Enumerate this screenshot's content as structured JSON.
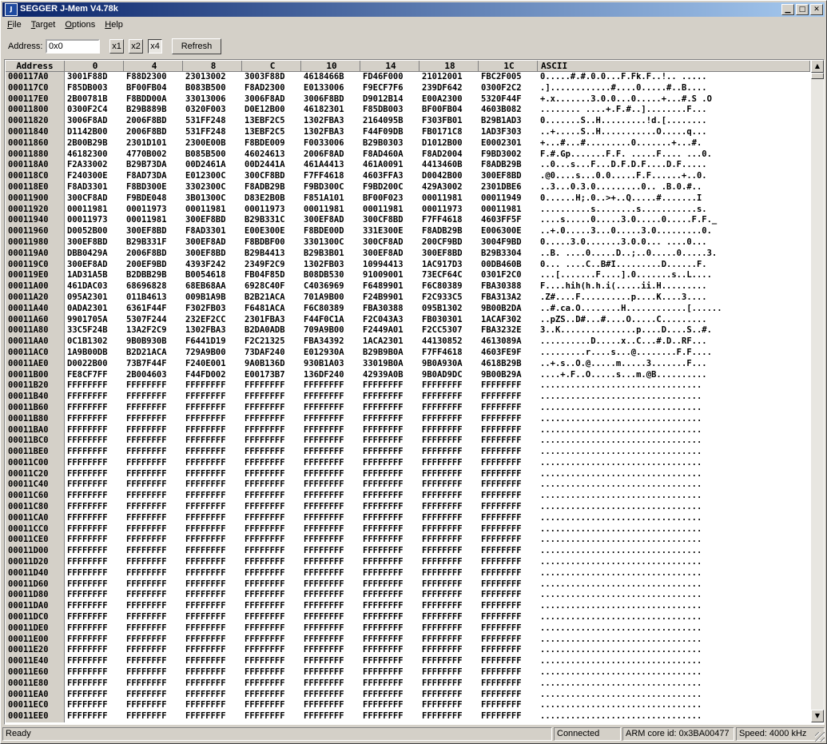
{
  "window": {
    "title": "SEGGER J-Mem V4.78k",
    "icon_text": "J"
  },
  "menu": [
    {
      "label": "File",
      "key": "F"
    },
    {
      "label": "Target",
      "key": "T"
    },
    {
      "label": "Options",
      "key": "O"
    },
    {
      "label": "Help",
      "key": "H"
    }
  ],
  "toolbar": {
    "address_label": "Address:",
    "address_value": "0x0",
    "zoom_buttons": [
      "x1",
      "x2",
      "x4"
    ],
    "zoom_selected": "x4",
    "refresh_label": "Refresh"
  },
  "grid": {
    "headers": [
      "Address",
      "0",
      "4",
      "8",
      "C",
      "10",
      "14",
      "18",
      "1C",
      "ASCII"
    ],
    "rows": [
      [
        "000117A0",
        "3001F88D",
        "F88D2300",
        "23013002",
        "3003F88D",
        "4618466B",
        "FD46F000",
        "21012001",
        "FBC2F005",
        "0.....#.#.0.0...F.Fk.F..!.. ....."
      ],
      [
        "000117C0",
        "F85DB003",
        "BF00FB04",
        "B083B500",
        "F8AD2300",
        "E0133006",
        "F9ECF7F6",
        "239DF642",
        "0300F2C2",
        ".]............#....0.....#..B...."
      ],
      [
        "000117E0",
        "2B00781B",
        "F8BDD00A",
        "33013006",
        "3006F8AD",
        "3006F8BD",
        "D9012B14",
        "E00A2300",
        "5320F44F",
        "+.x.......3.0.0...0.....+...#.S .O"
      ],
      [
        "00011800",
        "0300F2C4",
        "B29B889B",
        "0320F003",
        "D0E12B00",
        "46182301",
        "F85DB003",
        "BF00FB04",
        "4603B082",
        "........ ....+.F.#..]........F..."
      ],
      [
        "00011820",
        "3006F8AD",
        "2006F8BD",
        "531FF248",
        "13EBF2C5",
        "1302FBA3",
        "2164095B",
        "F303FB01",
        "B29B1AD3",
        "0.......S..H.........!d.[........"
      ],
      [
        "00011840",
        "D1142B00",
        "2006F8BD",
        "531FF248",
        "13EBF2C5",
        "1302FBA3",
        "F44F09DB",
        "FB0171C8",
        "1AD3F303",
        "..+.....S..H...........O.....q..."
      ],
      [
        "00011860",
        "2B00B29B",
        "2301D101",
        "2300E00B",
        "F8BDE009",
        "F0033006",
        "B29B0303",
        "D1012B00",
        "E0002301",
        "+...#...#.........0.......+...#."
      ],
      [
        "00011880",
        "46182300",
        "4770B002",
        "B085B500",
        "46024613",
        "2006F8AD",
        "F8AD460A",
        "F8AD2004",
        "F9BD3002",
        "F.#.Gp.......F.F. .....F.... ...0."
      ],
      [
        "000118A0",
        "F2A33002",
        "B29B73DA",
        "00D2461A",
        "00D2441A",
        "461A4413",
        "461A0091",
        "4413460B",
        "F8ADB29B",
        "..0...s...F...D.F.D.F....D.F....."
      ],
      [
        "000118C0",
        "F240300E",
        "F8AD73DA",
        "E012300C",
        "300CF8BD",
        "F7FF4618",
        "4603FFA3",
        "D0042B00",
        "300EF8BD",
        ".@0....s...0.0.....F.F......+..0."
      ],
      [
        "000118E0",
        "F8AD3301",
        "F8BD300E",
        "3302300C",
        "F8ADB29B",
        "F9BD300C",
        "F9BD200C",
        "429A3002",
        "2301DBE6",
        "..3...0.3.0.........0.. .B.0.#.."
      ],
      [
        "00011900",
        "300CF8AD",
        "F9BDE048",
        "3B01300C",
        "D83E2B0B",
        "F851A101",
        "BF00F023",
        "00011981",
        "00011949",
        "0......H;.0..>+..Q.....#.......I"
      ],
      [
        "00011920",
        "00011981",
        "00011973",
        "00011981",
        "00011973",
        "00011981",
        "00011981",
        "00011973",
        "00011981",
        "..........s........s...........s."
      ],
      [
        "00011940",
        "00011973",
        "00011981",
        "300EF8BD",
        "B29B331C",
        "300EF8AD",
        "300CF8BD",
        "F7FF4618",
        "4603FF5F",
        "....s.....0.....3.0.....0.....F.F._"
      ],
      [
        "00011960",
        "D0052B00",
        "300EF8BD",
        "F8AD3301",
        "E00E300E",
        "F8BDE00D",
        "331E300E",
        "F8ADB29B",
        "E006300E",
        "..+.0.....3...0.....3.0.........0."
      ],
      [
        "00011980",
        "300EF8BD",
        "B29B331F",
        "300EF8AD",
        "F8BDBF00",
        "3301300C",
        "300CF8AD",
        "200CF9BD",
        "3004F9BD",
        "0.....3.0.......3.0.0... ....0..."
      ],
      [
        "000119A0",
        "DBB0429A",
        "2006F8BD",
        "300EF8BD",
        "B29B4413",
        "B29B3B01",
        "300EF8AD",
        "300EF8BD",
        "B29B3304",
        "..B. ....0.....D..;..0.....0.....3."
      ],
      [
        "000119C0",
        "300EF8AD",
        "200EF9BD",
        "4393F242",
        "2349F2C9",
        "1302FB03",
        "10994413",
        "1AC917D3",
        "00DB460B",
        "0... ....C..B#I.........D......F."
      ],
      [
        "000119E0",
        "1AD31A5B",
        "B2DBB29B",
        "B0054618",
        "FB04F85D",
        "B08DB530",
        "91009001",
        "73ECF64C",
        "0301F2C0",
        "...[.......F....].0.......s..L...."
      ],
      [
        "00011A00",
        "461DAC03",
        "68696828",
        "68EB68AA",
        "6928C40F",
        "C4036969",
        "F6489901",
        "F6C80389",
        "FBA30388",
        "F....hih(h.h.i(.....ii.H........."
      ],
      [
        "00011A20",
        "095A2301",
        "011B4613",
        "009B1A9B",
        "B2B21ACA",
        "701A9B00",
        "F24B9901",
        "F2C933C5",
        "FBA313A2",
        ".Z#....F..........p....K....3...."
      ],
      [
        "00011A40",
        "0ADA2301",
        "6361F44F",
        "F302FB03",
        "F6481ACA",
        "F6C80389",
        "FBA30388",
        "095B1302",
        "9B00B2DA",
        "..#.ca.O........H............[......"
      ],
      [
        "00011A60",
        "9901705A",
        "5307F244",
        "232EF2CC",
        "2301FBA3",
        "F44F0C1A",
        "F2C043A3",
        "FB030301",
        "1ACAF302",
        "..pZS..D#...#....O.....C........."
      ],
      [
        "00011A80",
        "33C5F24B",
        "13A2F2C9",
        "1302FBA3",
        "B2DA0ADB",
        "709A9B00",
        "F2449A01",
        "F2CC5307",
        "FBA3232E",
        "3..K...............p....D....S..#."
      ],
      [
        "00011AA0",
        "0C1B1302",
        "9B0B930B",
        "F6441D19",
        "F2C21325",
        "FBA34392",
        "1ACA2301",
        "44130852",
        "4613089A",
        "..........D.....x..C...#.D..RF..."
      ],
      [
        "00011AC0",
        "1A9B00DB",
        "B2D21ACA",
        "729A9B00",
        "73DAF240",
        "E012930A",
        "B29B9B0A",
        "F7FF4618",
        "4603FE9F",
        ".........r....s...@........F.F...."
      ],
      [
        "00011AE0",
        "D0022B00",
        "73B7F44F",
        "F240E001",
        "9A0B136D",
        "930B1A03",
        "33019B0A",
        "9B0A930A",
        "4618B29B",
        "..+.s..O.@.....m.....3.......F..."
      ],
      [
        "00011B00",
        "FE8CF7FF",
        "2B004603",
        "F44FD002",
        "E00173B7",
        "136DF240",
        "42939A0B",
        "9B0AD9DC",
        "9B00B29A",
        "....+.F..O.....s...m.@B.........."
      ],
      [
        "00011B20",
        "FFFFFFFF",
        "FFFFFFFF",
        "FFFFFFFF",
        "FFFFFFFF",
        "FFFFFFFF",
        "FFFFFFFF",
        "FFFFFFFF",
        "FFFFFFFF",
        "................................"
      ],
      [
        "00011B40",
        "FFFFFFFF",
        "FFFFFFFF",
        "FFFFFFFF",
        "FFFFFFFF",
        "FFFFFFFF",
        "FFFFFFFF",
        "FFFFFFFF",
        "FFFFFFFF",
        "................................"
      ],
      [
        "00011B60",
        "FFFFFFFF",
        "FFFFFFFF",
        "FFFFFFFF",
        "FFFFFFFF",
        "FFFFFFFF",
        "FFFFFFFF",
        "FFFFFFFF",
        "FFFFFFFF",
        "................................"
      ],
      [
        "00011B80",
        "FFFFFFFF",
        "FFFFFFFF",
        "FFFFFFFF",
        "FFFFFFFF",
        "FFFFFFFF",
        "FFFFFFFF",
        "FFFFFFFF",
        "FFFFFFFF",
        "................................"
      ],
      [
        "00011BA0",
        "FFFFFFFF",
        "FFFFFFFF",
        "FFFFFFFF",
        "FFFFFFFF",
        "FFFFFFFF",
        "FFFFFFFF",
        "FFFFFFFF",
        "FFFFFFFF",
        "................................"
      ],
      [
        "00011BC0",
        "FFFFFFFF",
        "FFFFFFFF",
        "FFFFFFFF",
        "FFFFFFFF",
        "FFFFFFFF",
        "FFFFFFFF",
        "FFFFFFFF",
        "FFFFFFFF",
        "................................"
      ],
      [
        "00011BE0",
        "FFFFFFFF",
        "FFFFFFFF",
        "FFFFFFFF",
        "FFFFFFFF",
        "FFFFFFFF",
        "FFFFFFFF",
        "FFFFFFFF",
        "FFFFFFFF",
        "................................"
      ],
      [
        "00011C00",
        "FFFFFFFF",
        "FFFFFFFF",
        "FFFFFFFF",
        "FFFFFFFF",
        "FFFFFFFF",
        "FFFFFFFF",
        "FFFFFFFF",
        "FFFFFFFF",
        "................................"
      ],
      [
        "00011C20",
        "FFFFFFFF",
        "FFFFFFFF",
        "FFFFFFFF",
        "FFFFFFFF",
        "FFFFFFFF",
        "FFFFFFFF",
        "FFFFFFFF",
        "FFFFFFFF",
        "................................"
      ],
      [
        "00011C40",
        "FFFFFFFF",
        "FFFFFFFF",
        "FFFFFFFF",
        "FFFFFFFF",
        "FFFFFFFF",
        "FFFFFFFF",
        "FFFFFFFF",
        "FFFFFFFF",
        "................................"
      ],
      [
        "00011C60",
        "FFFFFFFF",
        "FFFFFFFF",
        "FFFFFFFF",
        "FFFFFFFF",
        "FFFFFFFF",
        "FFFFFFFF",
        "FFFFFFFF",
        "FFFFFFFF",
        "................................"
      ],
      [
        "00011C80",
        "FFFFFFFF",
        "FFFFFFFF",
        "FFFFFFFF",
        "FFFFFFFF",
        "FFFFFFFF",
        "FFFFFFFF",
        "FFFFFFFF",
        "FFFFFFFF",
        "................................"
      ],
      [
        "00011CA0",
        "FFFFFFFF",
        "FFFFFFFF",
        "FFFFFFFF",
        "FFFFFFFF",
        "FFFFFFFF",
        "FFFFFFFF",
        "FFFFFFFF",
        "FFFFFFFF",
        "................................"
      ],
      [
        "00011CC0",
        "FFFFFFFF",
        "FFFFFFFF",
        "FFFFFFFF",
        "FFFFFFFF",
        "FFFFFFFF",
        "FFFFFFFF",
        "FFFFFFFF",
        "FFFFFFFF",
        "................................"
      ],
      [
        "00011CE0",
        "FFFFFFFF",
        "FFFFFFFF",
        "FFFFFFFF",
        "FFFFFFFF",
        "FFFFFFFF",
        "FFFFFFFF",
        "FFFFFFFF",
        "FFFFFFFF",
        "................................"
      ],
      [
        "00011D00",
        "FFFFFFFF",
        "FFFFFFFF",
        "FFFFFFFF",
        "FFFFFFFF",
        "FFFFFFFF",
        "FFFFFFFF",
        "FFFFFFFF",
        "FFFFFFFF",
        "................................"
      ],
      [
        "00011D20",
        "FFFFFFFF",
        "FFFFFFFF",
        "FFFFFFFF",
        "FFFFFFFF",
        "FFFFFFFF",
        "FFFFFFFF",
        "FFFFFFFF",
        "FFFFFFFF",
        "................................"
      ],
      [
        "00011D40",
        "FFFFFFFF",
        "FFFFFFFF",
        "FFFFFFFF",
        "FFFFFFFF",
        "FFFFFFFF",
        "FFFFFFFF",
        "FFFFFFFF",
        "FFFFFFFF",
        "................................"
      ],
      [
        "00011D60",
        "FFFFFFFF",
        "FFFFFFFF",
        "FFFFFFFF",
        "FFFFFFFF",
        "FFFFFFFF",
        "FFFFFFFF",
        "FFFFFFFF",
        "FFFFFFFF",
        "................................"
      ],
      [
        "00011D80",
        "FFFFFFFF",
        "FFFFFFFF",
        "FFFFFFFF",
        "FFFFFFFF",
        "FFFFFFFF",
        "FFFFFFFF",
        "FFFFFFFF",
        "FFFFFFFF",
        "................................"
      ],
      [
        "00011DA0",
        "FFFFFFFF",
        "FFFFFFFF",
        "FFFFFFFF",
        "FFFFFFFF",
        "FFFFFFFF",
        "FFFFFFFF",
        "FFFFFFFF",
        "FFFFFFFF",
        "................................"
      ],
      [
        "00011DC0",
        "FFFFFFFF",
        "FFFFFFFF",
        "FFFFFFFF",
        "FFFFFFFF",
        "FFFFFFFF",
        "FFFFFFFF",
        "FFFFFFFF",
        "FFFFFFFF",
        "................................"
      ],
      [
        "00011DE0",
        "FFFFFFFF",
        "FFFFFFFF",
        "FFFFFFFF",
        "FFFFFFFF",
        "FFFFFFFF",
        "FFFFFFFF",
        "FFFFFFFF",
        "FFFFFFFF",
        "................................"
      ],
      [
        "00011E00",
        "FFFFFFFF",
        "FFFFFFFF",
        "FFFFFFFF",
        "FFFFFFFF",
        "FFFFFFFF",
        "FFFFFFFF",
        "FFFFFFFF",
        "FFFFFFFF",
        "................................"
      ],
      [
        "00011E20",
        "FFFFFFFF",
        "FFFFFFFF",
        "FFFFFFFF",
        "FFFFFFFF",
        "FFFFFFFF",
        "FFFFFFFF",
        "FFFFFFFF",
        "FFFFFFFF",
        "................................"
      ],
      [
        "00011E40",
        "FFFFFFFF",
        "FFFFFFFF",
        "FFFFFFFF",
        "FFFFFFFF",
        "FFFFFFFF",
        "FFFFFFFF",
        "FFFFFFFF",
        "FFFFFFFF",
        "................................"
      ],
      [
        "00011E60",
        "FFFFFFFF",
        "FFFFFFFF",
        "FFFFFFFF",
        "FFFFFFFF",
        "FFFFFFFF",
        "FFFFFFFF",
        "FFFFFFFF",
        "FFFFFFFF",
        "................................"
      ],
      [
        "00011E80",
        "FFFFFFFF",
        "FFFFFFFF",
        "FFFFFFFF",
        "FFFFFFFF",
        "FFFFFFFF",
        "FFFFFFFF",
        "FFFFFFFF",
        "FFFFFFFF",
        "................................"
      ],
      [
        "00011EA0",
        "FFFFFFFF",
        "FFFFFFFF",
        "FFFFFFFF",
        "FFFFFFFF",
        "FFFFFFFF",
        "FFFFFFFF",
        "FFFFFFFF",
        "FFFFFFFF",
        "................................"
      ],
      [
        "00011EC0",
        "FFFFFFFF",
        "FFFFFFFF",
        "FFFFFFFF",
        "FFFFFFFF",
        "FFFFFFFF",
        "FFFFFFFF",
        "FFFFFFFF",
        "FFFFFFFF",
        "................................"
      ],
      [
        "00011EE0",
        "FFFFFFFF",
        "FFFFFFFF",
        "FFFFFFFF",
        "FFFFFFFF",
        "FFFFFFFF",
        "FFFFFFFF",
        "FFFFFFFF",
        "FFFFFFFF",
        "................................"
      ]
    ]
  },
  "status": {
    "ready": "Ready",
    "connection": "Connected",
    "core_id": "ARM core id: 0x3BA00477",
    "speed": "Speed: 4000 kHz"
  },
  "colors": {
    "title_start": "#0a246a",
    "title_end": "#a6caf0",
    "face": "#d4d0c8"
  },
  "icons": {
    "minimize": "minimize-icon",
    "maximize": "maximize-icon",
    "close": "close-icon",
    "scroll_up": "arrow-up-icon",
    "scroll_down": "arrow-down-icon"
  }
}
